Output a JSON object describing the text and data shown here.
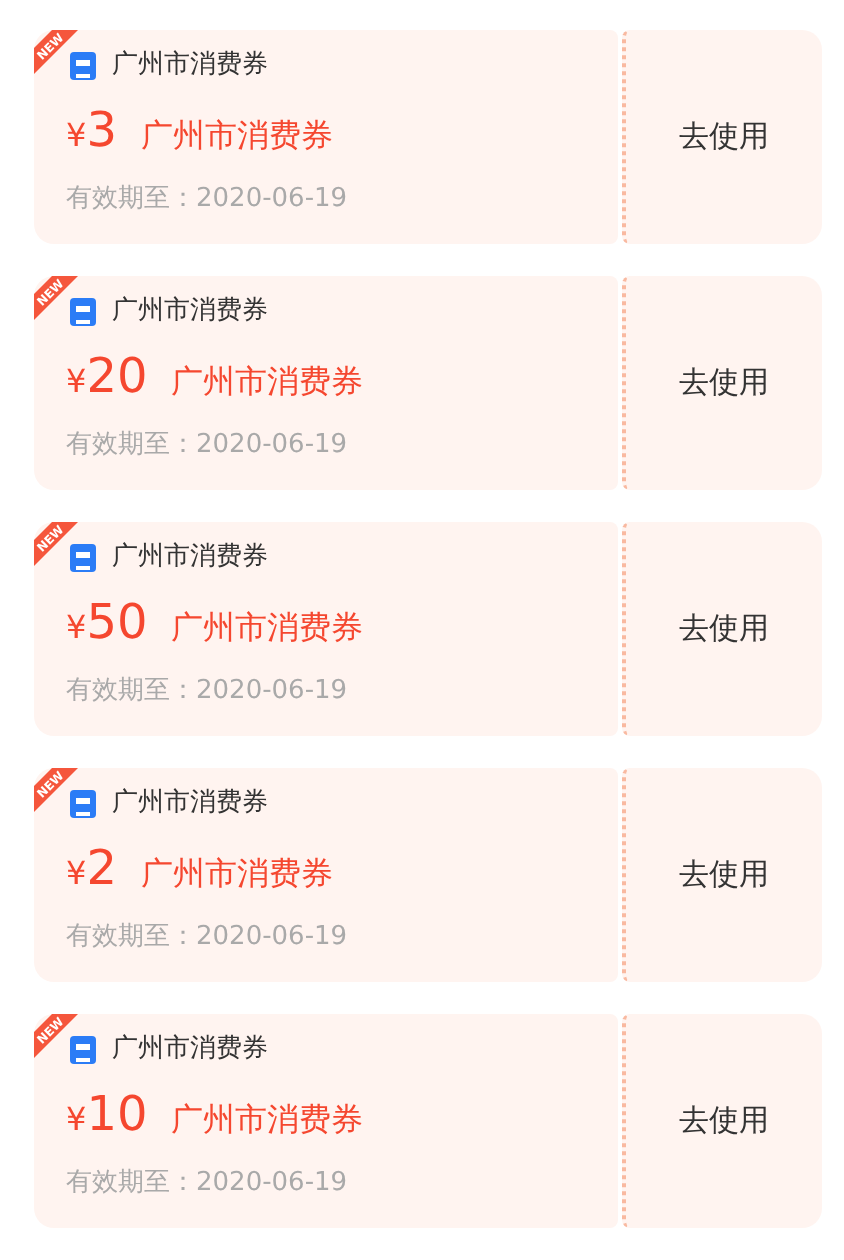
{
  "coupons": [
    {
      "badge": "NEW",
      "issuer": "广州市消费券",
      "currency": "¥",
      "value": "3",
      "title": "广州市消费券",
      "expiry": "有效期至：2020-06-19",
      "action": "去使用"
    },
    {
      "badge": "NEW",
      "issuer": "广州市消费券",
      "currency": "¥",
      "value": "20",
      "title": "广州市消费券",
      "expiry": "有效期至：2020-06-19",
      "action": "去使用"
    },
    {
      "badge": "NEW",
      "issuer": "广州市消费券",
      "currency": "¥",
      "value": "50",
      "title": "广州市消费券",
      "expiry": "有效期至：2020-06-19",
      "action": "去使用"
    },
    {
      "badge": "NEW",
      "issuer": "广州市消费券",
      "currency": "¥",
      "value": "2",
      "title": "广州市消费券",
      "expiry": "有效期至：2020-06-19",
      "action": "去使用"
    },
    {
      "badge": "NEW",
      "issuer": "广州市消费券",
      "currency": "¥",
      "value": "10",
      "title": "广州市消费券",
      "expiry": "有效期至：2020-06-19",
      "action": "去使用"
    }
  ]
}
